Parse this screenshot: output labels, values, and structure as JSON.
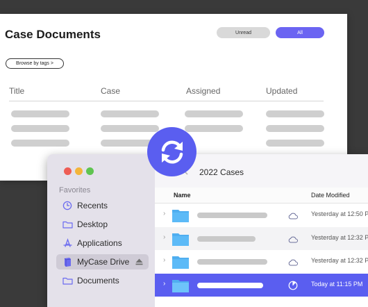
{
  "colors": {
    "accent": "#5a5ef0",
    "pill_all": "#6b64f2",
    "skeleton": "#cfcfcf",
    "sidebar_bg": "#e4e1ea",
    "folder": "#4faef0",
    "traffic_red": "#ee5d55",
    "traffic_yellow": "#f3b53a",
    "traffic_green": "#5fc450"
  },
  "web_panel": {
    "title": "Case Documents",
    "filters": {
      "unread": "Unread",
      "all": "All"
    },
    "browse_button": "Browse by tags >",
    "columns": [
      "Title",
      "Case",
      "Assigned",
      "Updated"
    ]
  },
  "sync_badge": {
    "icon": "sync-icon"
  },
  "finder": {
    "sidebar": {
      "section_label": "Favorites",
      "items": [
        {
          "label": "Recents",
          "icon": "clock-icon"
        },
        {
          "label": "Desktop",
          "icon": "folder-icon"
        },
        {
          "label": "Applications",
          "icon": "applications-icon"
        },
        {
          "label": "MyCase Drive",
          "icon": "drive-icon",
          "selected": true,
          "trailing_icon": "eject-icon"
        },
        {
          "label": "Documents",
          "icon": "folder-icon"
        }
      ]
    },
    "toolbar": {
      "back_icon": "chevron-left-icon",
      "title": "2022 Cases"
    },
    "list": {
      "columns": {
        "name": "Name",
        "date_modified": "Date Modified"
      },
      "rows": [
        {
          "date": "Yesterday at 12:50 P",
          "status_icon": "cloud-icon",
          "selected": false
        },
        {
          "date": "Yesterday at 12:32 P",
          "status_icon": "cloud-icon",
          "selected": false
        },
        {
          "date": "Yesterday at 12:32 P",
          "status_icon": "cloud-icon",
          "selected": false
        },
        {
          "date": "Today at 11:15 PM",
          "status_icon": "syncing-progress-icon",
          "selected": true
        }
      ]
    }
  }
}
